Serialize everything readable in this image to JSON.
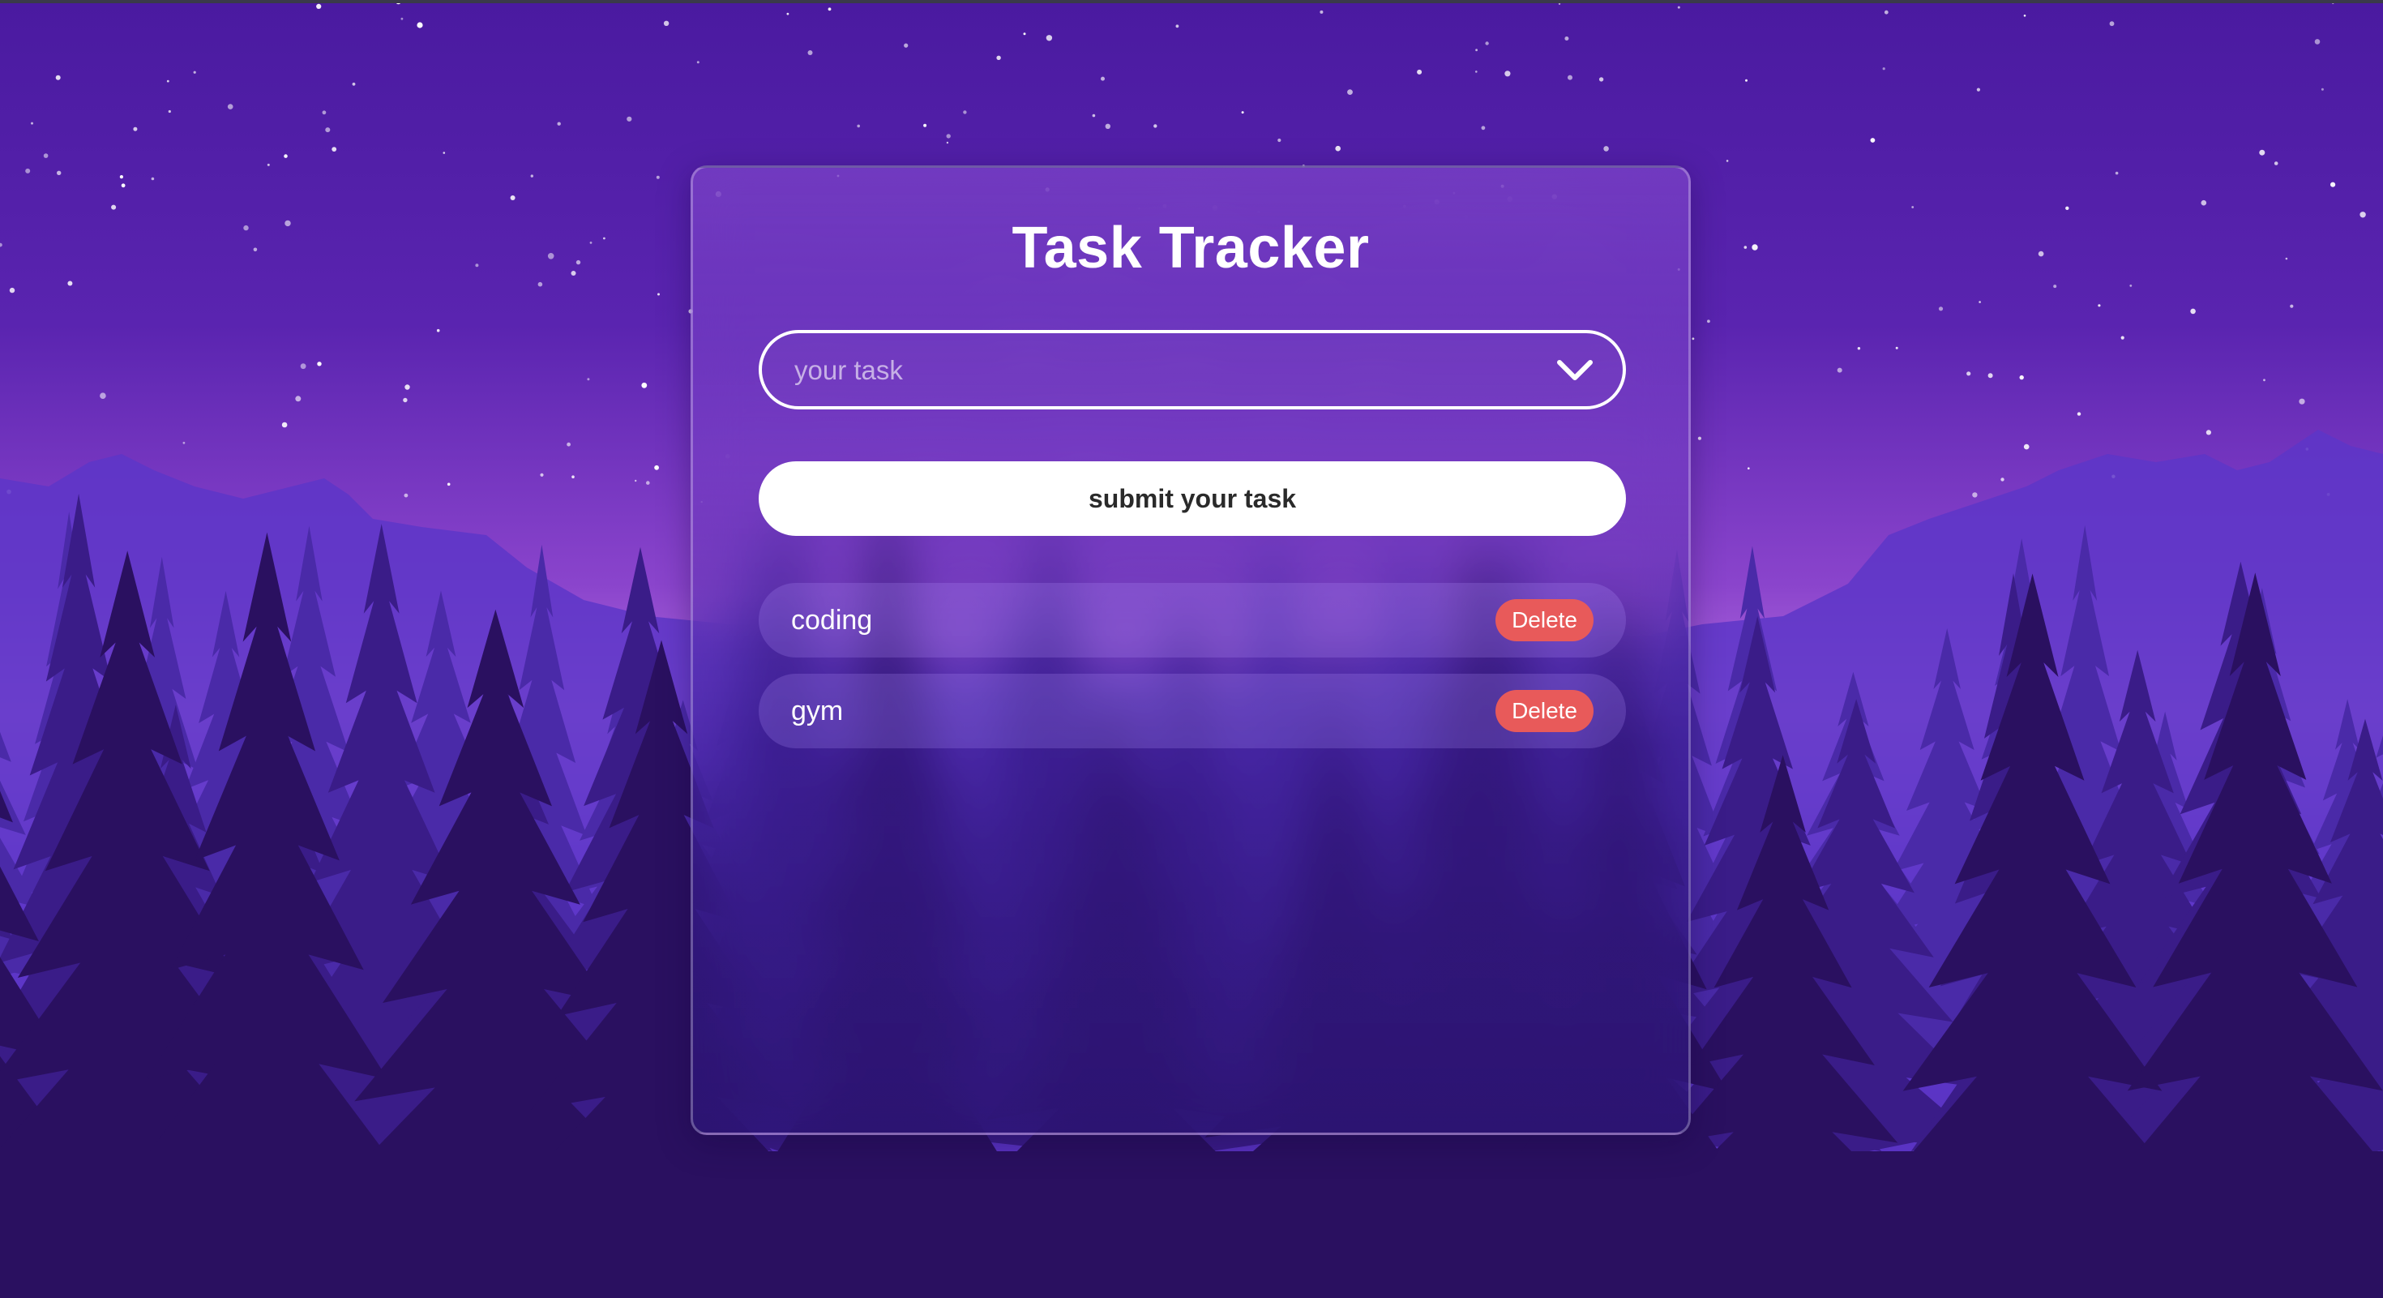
{
  "app": {
    "title": "Task Tracker"
  },
  "task_input": {
    "placeholder": "your task",
    "icon": "chevron-down-icon"
  },
  "submit": {
    "label": "submit your task"
  },
  "tasks": [
    {
      "label": "coding",
      "delete_label": "Delete"
    },
    {
      "label": "gym",
      "delete_label": "Delete"
    }
  ],
  "colors": {
    "sky_top": "#4a1aa0",
    "sky_horizon": "#b56ee0",
    "mountains": "#6a3fd0",
    "trees_far": "#4a2aa8",
    "trees_near": "#2a1060",
    "delete": "#e85a5a",
    "button": "#ffffff"
  }
}
